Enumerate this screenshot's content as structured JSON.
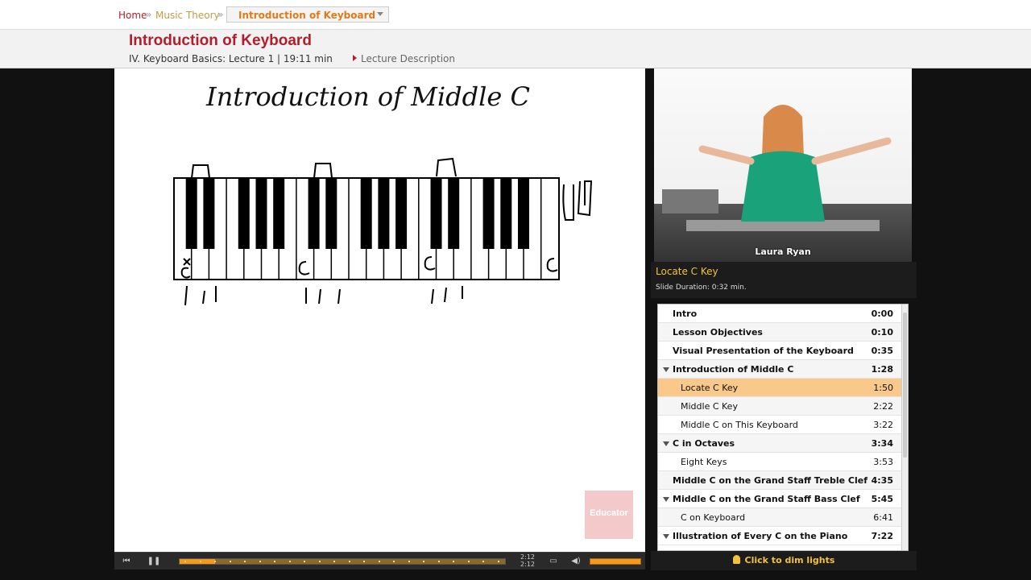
{
  "breadcrumb": {
    "home": "Home",
    "sep": "»",
    "section": "Music Theory",
    "current": "Introduction of Keyboard"
  },
  "header": {
    "title": "Introduction of Keyboard",
    "meta": "IV. Keyboard Basics: Lecture 1 | 19:11 min",
    "description_link": "Lecture Description"
  },
  "slide": {
    "title": "Introduction of Middle C",
    "watermark": "Educator"
  },
  "player": {
    "time_current": "2:12",
    "time_total": "2:12",
    "progress": 0.11,
    "volume": 1.0,
    "prev_icon": "skip-back-icon",
    "pause_icon": "pause-icon",
    "screen_icon": "fullscreen-icon",
    "volume_icon": "speaker-icon"
  },
  "video": {
    "presenter": "Laura Ryan"
  },
  "current_slide": {
    "name": "Locate C Key",
    "duration": "Slide Duration: 0:32 min."
  },
  "outline": [
    {
      "label": "Intro",
      "time": "0:00",
      "level": 0,
      "expanded": false,
      "active": false
    },
    {
      "label": "Lesson Objectives",
      "time": "0:10",
      "level": 0,
      "expanded": false,
      "active": false
    },
    {
      "label": "Visual Presentation of the Keyboard",
      "time": "0:35",
      "level": 0,
      "expanded": false,
      "active": false
    },
    {
      "label": "Introduction of Middle C",
      "time": "1:28",
      "level": 0,
      "expanded": true,
      "active": false
    },
    {
      "label": "Locate C Key",
      "time": "1:50",
      "level": 1,
      "expanded": false,
      "active": true
    },
    {
      "label": "Middle C Key",
      "time": "2:22",
      "level": 1,
      "expanded": false,
      "active": false
    },
    {
      "label": "Middle C on This Keyboard",
      "time": "3:22",
      "level": 1,
      "expanded": false,
      "active": false
    },
    {
      "label": "C in Octaves",
      "time": "3:34",
      "level": 0,
      "expanded": true,
      "active": false
    },
    {
      "label": "Eight Keys",
      "time": "3:53",
      "level": 1,
      "expanded": false,
      "active": false
    },
    {
      "label": "Middle C on the Grand Staff Treble Clef",
      "time": "4:35",
      "level": 0,
      "expanded": false,
      "active": false
    },
    {
      "label": "Middle C on the Grand Staff Bass Clef",
      "time": "5:45",
      "level": 0,
      "expanded": true,
      "active": false
    },
    {
      "label": "C on Keyboard",
      "time": "6:41",
      "level": 1,
      "expanded": false,
      "active": false
    },
    {
      "label": "Illustration of Every C on the Piano",
      "time": "7:22",
      "level": 0,
      "expanded": true,
      "active": false
    }
  ],
  "dim_lights": "Click to dim lights"
}
